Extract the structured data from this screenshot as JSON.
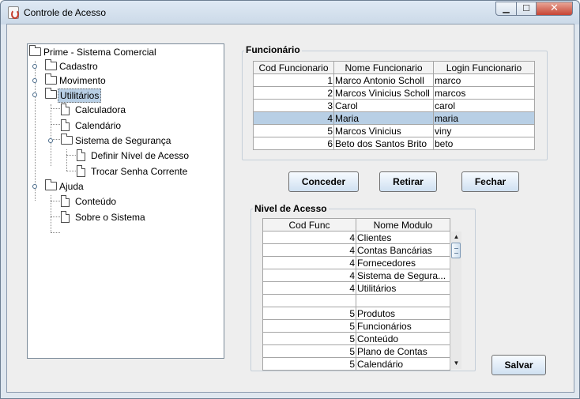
{
  "window": {
    "title": "Controle de Acesso",
    "controls": {
      "minimize": "▁",
      "maximize": "☐",
      "close": "✕"
    }
  },
  "tree": {
    "root": "Prime - Sistema Comercial",
    "cadastro": "Cadastro",
    "movimento": "Movimento",
    "utilitarios": "Utilitários",
    "calculadora": "Calculadora",
    "calendario": "Calendário",
    "sistema_seguranca": "Sistema de Segurança",
    "definir_nivel": "Definir Nível de Acesso",
    "trocar_senha": "Trocar Senha Corrente",
    "ajuda": "Ajuda",
    "conteudo": "Conteúdo",
    "sobre": "Sobre o Sistema"
  },
  "funcionario": {
    "title": "Funcionário",
    "headers": [
      "Cod Funcionario",
      "Nome Funcionario",
      "Login Funcionario"
    ],
    "rows": [
      [
        "1",
        "Marco Antonio Scholl",
        "marco"
      ],
      [
        "2",
        "Marcos Vinicius Scholl",
        "marcos"
      ],
      [
        "3",
        "Carol",
        "carol"
      ],
      [
        "4",
        "Maria",
        "maria"
      ],
      [
        "5",
        "Marcos Vinicius",
        "viny"
      ],
      [
        "6",
        "Beto dos Santos Brito",
        "beto"
      ]
    ],
    "selected_row": 3
  },
  "buttons": {
    "conceder": "Conceder",
    "retirar": "Retirar",
    "fechar": "Fechar",
    "salvar": "Salvar"
  },
  "nivel": {
    "title": "Nivel de Acesso",
    "headers": [
      "Cod Func",
      "Nome Modulo"
    ],
    "rows": [
      [
        "4",
        "Clientes"
      ],
      [
        "4",
        "Contas Bancárias"
      ],
      [
        "4",
        "Fornecedores"
      ],
      [
        "4",
        "Sistema de Segura..."
      ],
      [
        "4",
        "Utilitários"
      ],
      [
        "",
        ""
      ],
      [
        "5",
        "Produtos"
      ],
      [
        "5",
        "Funcionários"
      ],
      [
        "5",
        "Conteúdo"
      ],
      [
        "5",
        "Plano de Contas"
      ],
      [
        "5",
        "Calendário"
      ]
    ]
  }
}
